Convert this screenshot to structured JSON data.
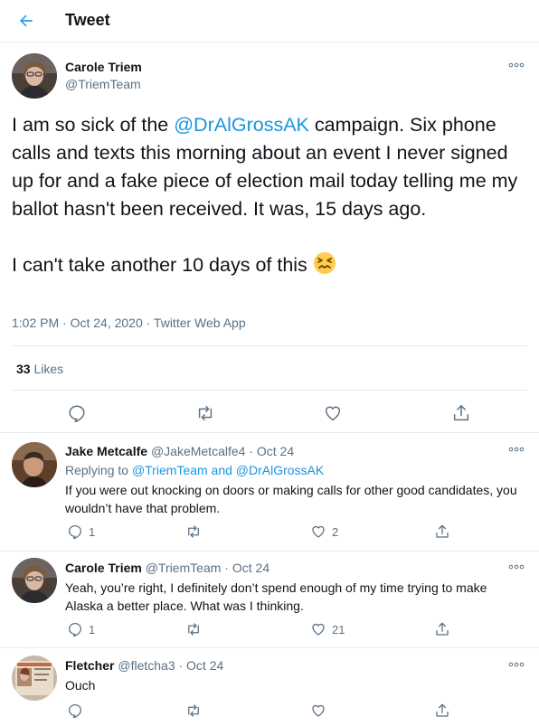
{
  "header": {
    "title": "Tweet"
  },
  "tweet": {
    "author_name": "Carole Triem",
    "author_handle": "@TriemTeam",
    "text_before_mention": "I am so sick of the ",
    "mention": "@DrAlGrossAK",
    "text_after_mention": " campaign. Six phone calls and texts this morning about an event I never signed up for and a fake piece of election mail today telling me my ballot hasn't been received. It was, 15 days ago.\n\nI can't take another 10 days of this",
    "emoji": "confounded-face",
    "meta": "1:02 PM · Oct 24, 2020 · Twitter Web App",
    "likes_count": "33",
    "likes_label": " Likes"
  },
  "replies": [
    {
      "name": "Jake Metcalfe",
      "handle_date": " @JakeMetcalfe4 · Oct 24",
      "replying_prefix": "Replying to ",
      "replying_to": "@TriemTeam and @DrAlGrossAK",
      "text": "If you were out knocking on doors or making calls for other good candidates, you wouldn’t have that problem.",
      "reply_count": "1",
      "retweet_count": "",
      "like_count": "2"
    },
    {
      "name": "Carole Triem",
      "handle_date": " @TriemTeam · Oct 24",
      "text": "Yeah, you’re right, I definitely don’t spend enough of my time trying to make Alaska a better place. What was I thinking.",
      "reply_count": "1",
      "retweet_count": "",
      "like_count": "21"
    },
    {
      "name": "Fletcher",
      "handle_date": " @fletcha3 · Oct 24",
      "text": "Ouch",
      "reply_count": "",
      "retweet_count": "",
      "like_count": ""
    }
  ],
  "colors": {
    "accent": "#1da1f2",
    "link": "#1b95e0",
    "secondary": "#5b7083",
    "divider": "#e6ecf0"
  }
}
